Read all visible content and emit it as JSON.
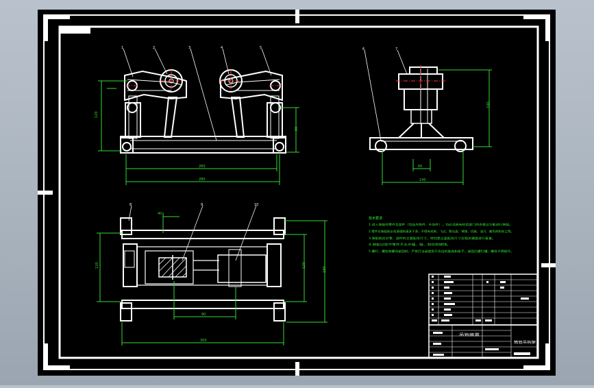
{
  "colors": {
    "background": "#a9b3be",
    "paper": "#000000",
    "lines": "#ffffff",
    "dimensions": "#33dd33",
    "leaders": "#ffffff",
    "center_lines": "#ff3030",
    "notes": "#33ee33"
  },
  "title_block": {
    "drawing_title": "筒管吊钩架",
    "drawing_number": "吊钩装置"
  },
  "notes": {
    "heading": "技术要求",
    "lines": [
      "1.进入装配的零件及部件（包括外购件、外协件），均必须具有检验部门的合格证方能进行装配。",
      "2.零件在装配前必须清理和清洗干净，不得有毛刺、飞边、氧化皮、锈蚀、切屑、油污、着色剂和灰尘等。",
      "3.装配前应对零、部件的主要配合尺寸，特别是过盈配合尺寸及相关精度进行复查。",
      "4.装配过程中零件不允许磕、碰、划伤和锈蚀。",
      "5.螺钉、螺栓和螺母紧固时，严禁打击或使用不合适的旋具和扳手，紧固后螺钉槽、螺母不得损坏。"
    ]
  }
}
